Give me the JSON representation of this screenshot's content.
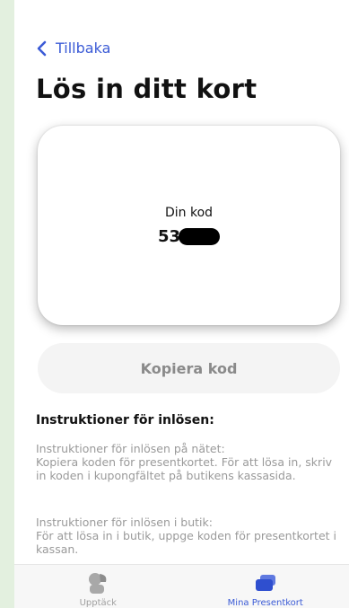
{
  "header": {
    "back_label": "Tillbaka",
    "title": "Lös in ditt kort"
  },
  "card": {
    "code_label": "Din kod",
    "code_visible": "53"
  },
  "copy_button_label": "Kopiera kod",
  "instructions": {
    "heading": "Instruktioner för inlösen:",
    "online_title": "Instruktioner för inlösen på nätet:",
    "online_text": "Kopiera koden för presentkortet. För att lösa in, skriv in koden i kupongfältet på butikens kassasida.",
    "store_title": "Instruktioner för inlösen i butik:",
    "store_text": "För att lösa in i butik, uppge koden för presentkortet i kassan."
  },
  "tabbar": {
    "tabs": [
      {
        "label": "Upptäck",
        "icon": "discover-icon",
        "active": false
      },
      {
        "label": "Mina Presentkort",
        "icon": "cards-icon",
        "active": true
      }
    ]
  },
  "colors": {
    "accent": "#3b5bd6",
    "background_outer": "#e3f0df",
    "muted_text": "#9a9a9a"
  }
}
